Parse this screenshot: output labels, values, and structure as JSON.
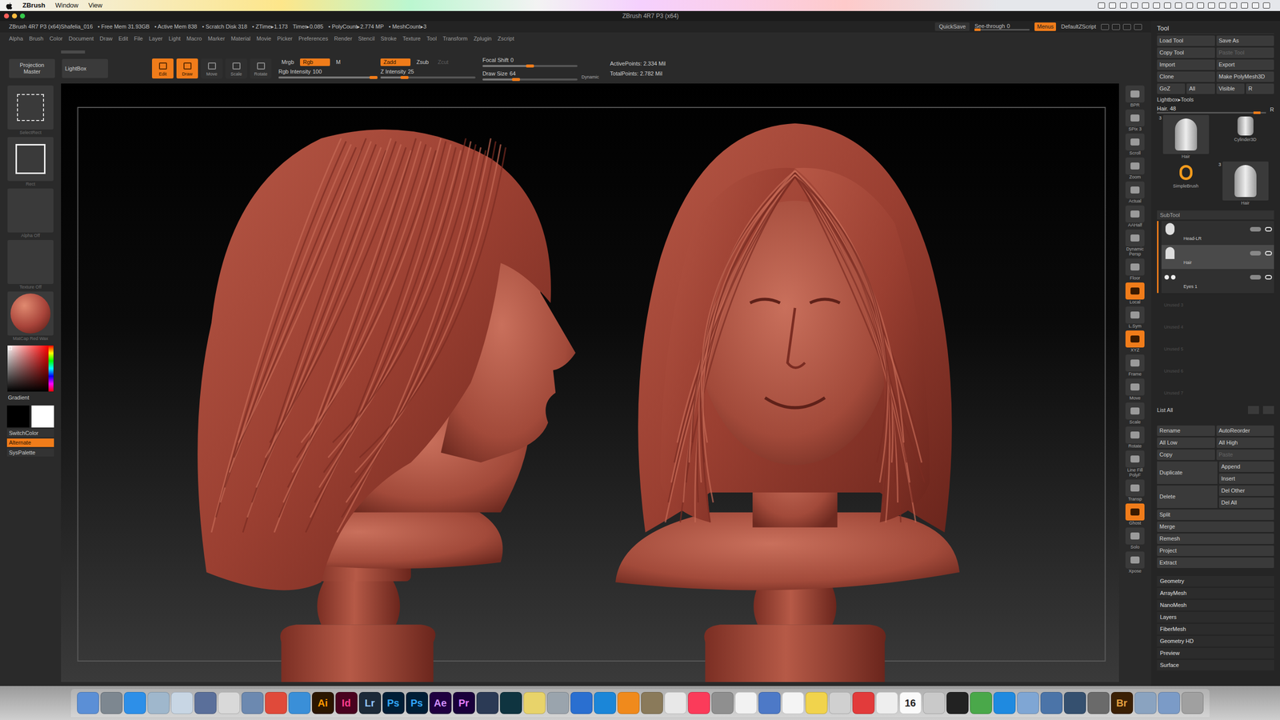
{
  "os_menubar": {
    "app": "ZBrush",
    "menus": [
      "Window",
      "View"
    ]
  },
  "window": {
    "title": "ZBrush 4R7 P3 (x64)"
  },
  "info_bar": {
    "items": [
      "ZBrush 4R7 P3 (x64)Shafelia_016",
      "• Free Mem 31.93GB",
      "• Active Mem 838",
      "• Scratch Disk 318",
      "• ZTime▸1.173",
      "Timer▸0.085",
      "• PolyCount▸2.774 MP",
      "• MeshCount▸3"
    ],
    "quicksave": "QuickSave",
    "see_through": {
      "label": "See-through",
      "value": "0",
      "level": 0
    },
    "menus_toggle": {
      "label": "Menus",
      "on": true
    },
    "script": "DefaultZScript"
  },
  "menu_bar": [
    "Alpha",
    "Brush",
    "Color",
    "Document",
    "Draw",
    "Edit",
    "File",
    "Layer",
    "Light",
    "Macro",
    "Marker",
    "Material",
    "Movie",
    "Picker",
    "Preferences",
    "Render",
    "Stencil",
    "Stroke",
    "Texture",
    "Tool",
    "Transform",
    "Zplugin",
    "Zscript"
  ],
  "shelf": {
    "projection_master": "Projection Master",
    "lightbox": "LightBox",
    "modes": [
      {
        "label": "Edit",
        "selected": true
      },
      {
        "label": "Draw",
        "selected": true
      },
      {
        "label": "Move",
        "selected": false
      },
      {
        "label": "Scale",
        "selected": false
      },
      {
        "label": "Rotate",
        "selected": false
      }
    ],
    "color_modes": [
      {
        "label": "Mrgb",
        "selected": false
      },
      {
        "label": "Rgb",
        "selected": true
      },
      {
        "label": "M",
        "selected": false
      }
    ],
    "rgb_intensity": {
      "label": "Rgb Intensity",
      "value": "100",
      "level": 1
    },
    "z_modes": [
      {
        "label": "Zadd",
        "selected": true,
        "disabled": false
      },
      {
        "label": "Zsub",
        "selected": false,
        "disabled": false
      },
      {
        "label": "Zcut",
        "selected": false,
        "disabled": true
      }
    ],
    "z_intensity": {
      "label": "Z Intensity",
      "value": "25",
      "level": 0.25
    },
    "focal_shift": {
      "label": "Focal Shift",
      "value": "0",
      "level": 0.5
    },
    "draw_size": {
      "label": "Draw Size",
      "value": "64",
      "level": 0.35
    },
    "dynamic": "Dynamic",
    "active_points": "ActivePoints: 2.334 Mil",
    "total_points": "TotalPoints: 2.782 Mil"
  },
  "left_shelf": {
    "tiles": [
      {
        "label": "SelectRect",
        "kind": "selectrect"
      },
      {
        "label": "Rect",
        "kind": "rect"
      },
      {
        "label": "Alpha Off",
        "kind": "blank"
      },
      {
        "label": "Texture Off",
        "kind": "blank"
      },
      {
        "label": "MatCap Red Wax",
        "kind": "sphere"
      }
    ],
    "gradient": "Gradient",
    "primary_color": "#000000",
    "secondary_color": "#ffffff",
    "switch_color": "SwitchColor",
    "alternate": {
      "label": "Alternate",
      "on": true
    },
    "sys_palette": "SysPalette"
  },
  "right_shelf": [
    {
      "label": "BPR",
      "selected": false
    },
    {
      "label": "SPix 3",
      "selected": false
    },
    {
      "label": "Scroll",
      "selected": false
    },
    {
      "label": "Zoom",
      "selected": false
    },
    {
      "label": "Actual",
      "selected": false
    },
    {
      "label": "AAHalf",
      "selected": false
    },
    {
      "label": "Dynamic Persp",
      "selected": false
    },
    {
      "label": "Floor",
      "selected": false
    },
    {
      "label": "Local",
      "selected": true
    },
    {
      "label": "L.Sym",
      "selected": false
    },
    {
      "label": "XYZ",
      "selected": true
    },
    {
      "label": "Frame",
      "selected": false
    },
    {
      "label": "Move",
      "selected": false
    },
    {
      "label": "Scale",
      "selected": false
    },
    {
      "label": "Rotate",
      "selected": false
    },
    {
      "label": "Line Fill PolyF",
      "selected": false
    },
    {
      "label": "Transp",
      "selected": false
    },
    {
      "label": "Ghost",
      "selected": true
    },
    {
      "label": "Solo",
      "selected": false
    },
    {
      "label": "Xpose",
      "selected": false
    }
  ],
  "tool_panel": {
    "title": "Tool",
    "buttons": [
      [
        {
          "label": "Load Tool",
          "disabled": false
        },
        {
          "label": "Save As",
          "disabled": false
        }
      ],
      [
        {
          "label": "Copy Tool",
          "disabled": false
        },
        {
          "label": "Paste Tool",
          "disabled": true
        }
      ],
      [
        {
          "label": "Import",
          "disabled": false
        },
        {
          "label": "Export",
          "disabled": false
        }
      ],
      [
        {
          "label": "Clone",
          "disabled": false
        },
        {
          "label": "Make PolyMesh3D",
          "disabled": false
        }
      ],
      [
        {
          "label": "GoZ",
          "disabled": false
        },
        {
          "label": "All",
          "disabled": false
        },
        {
          "label": "Visible",
          "disabled": false
        },
        {
          "label": "R",
          "disabled": false
        }
      ]
    ],
    "lightbox_tools": "Lightbox▸Tools",
    "current": {
      "label": "Hair. 48",
      "level": 0.95,
      "reset": "R"
    },
    "thumbs": [
      {
        "label": "Hair",
        "count": "3",
        "kind": "hair"
      },
      {
        "label": "Cylinder3D",
        "count": "",
        "kind": "cylinder"
      },
      {
        "label": "SimpleBrush",
        "count": "",
        "kind": "brush"
      },
      {
        "label": "Hair",
        "count": "3",
        "kind": "hair"
      }
    ],
    "subtool": {
      "title": "SubTool",
      "items": [
        {
          "name": "Head-LR",
          "kind": "head",
          "selected": false,
          "visible": true
        },
        {
          "name": "Hair",
          "kind": "hair",
          "selected": true,
          "visible": true
        },
        {
          "name": "Eyes 1",
          "kind": "eyes",
          "selected": false,
          "visible": true
        }
      ],
      "unused": [
        "Unused 3",
        "Unused 4",
        "Unused 5",
        "Unused 6",
        "Unused 7"
      ],
      "list_all": "List All"
    },
    "actions": [
      [
        {
          "label": "Rename",
          "disabled": false
        },
        {
          "label": "AutoReorder",
          "disabled": false
        }
      ],
      [
        {
          "label": "All Low",
          "disabled": false
        },
        {
          "label": "All High",
          "disabled": false
        }
      ],
      [
        {
          "label": "Copy",
          "disabled": false
        },
        {
          "label": "Paste",
          "disabled": true
        }
      ]
    ],
    "duplicate": {
      "label": "Duplicate",
      "options": [
        "Append",
        "Insert"
      ]
    },
    "delete": {
      "label": "Delete",
      "options": [
        "Del Other",
        "Del All"
      ]
    },
    "single_actions": [
      "Split",
      "Merge",
      "Remesh",
      "Project",
      "Extract"
    ],
    "sections": [
      "Geometry",
      "ArrayMesh",
      "NanoMesh",
      "Layers",
      "FiberMesh",
      "Geometry HD",
      "Preview",
      "Surface"
    ]
  },
  "dock": [
    {
      "label": "",
      "color": "#5b8fd6",
      "text_color": "#ffffff"
    },
    {
      "label": "",
      "color": "#7d8790",
      "text_color": "#ffffff"
    },
    {
      "label": "",
      "color": "#2d8fe8",
      "text_color": "#ffffff"
    },
    {
      "label": "",
      "color": "#9fb7cc",
      "text_color": "#ffffff"
    },
    {
      "label": "",
      "color": "#c8d6e4",
      "text_color": "#ffffff"
    },
    {
      "label": "",
      "color": "#5a6f9a",
      "text_color": "#ffffff"
    },
    {
      "label": "",
      "color": "#d9d9d9",
      "text_color": "#ffffff"
    },
    {
      "label": "",
      "color": "#6c89b0",
      "text_color": "#ffffff"
    },
    {
      "label": "",
      "color": "#e04a3a",
      "text_color": "#ffffff"
    },
    {
      "label": "",
      "color": "#3a8fd8",
      "text_color": "#ffffff"
    },
    {
      "label": "Ai",
      "color": "#2b1600",
      "text_color": "#ff9a00"
    },
    {
      "label": "Id",
      "color": "#49021f",
      "text_color": "#ff3d8f"
    },
    {
      "label": "Lr",
      "color": "#1d2a38",
      "text_color": "#94c6ff"
    },
    {
      "label": "Ps",
      "color": "#001e36",
      "text_color": "#31a8ff"
    },
    {
      "label": "Ps",
      "color": "#001e36",
      "text_color": "#31a8ff"
    },
    {
      "label": "Ae",
      "color": "#1f0040",
      "text_color": "#d291ff"
    },
    {
      "label": "Pr",
      "color": "#1a003b",
      "text_color": "#e580ff"
    },
    {
      "label": "",
      "color": "#2b3a55",
      "text_color": "#ffffff"
    },
    {
      "label": "",
      "color": "#0f3440",
      "text_color": "#ffffff"
    },
    {
      "label": "",
      "color": "#e8d36a",
      "text_color": "#ffffff"
    },
    {
      "label": "",
      "color": "#9aa4ad",
      "text_color": "#ffffff"
    },
    {
      "label": "",
      "color": "#2a6fd0",
      "text_color": "#ffffff"
    },
    {
      "label": "",
      "color": "#1b86d8",
      "text_color": "#ffffff"
    },
    {
      "label": "",
      "color": "#f08a1c",
      "text_color": "#ffffff"
    },
    {
      "label": "",
      "color": "#8a7a5a",
      "text_color": "#ffffff"
    },
    {
      "label": "",
      "color": "#e8e8e8",
      "text_color": "#ffffff"
    },
    {
      "label": "",
      "color": "#fb3b5a",
      "text_color": "#ffffff"
    },
    {
      "label": "",
      "color": "#8f8f8f",
      "text_color": "#ffffff"
    },
    {
      "label": "",
      "color": "#f2f2f2",
      "text_color": "#ffffff"
    },
    {
      "label": "",
      "color": "#4d79c7",
      "text_color": "#ffffff"
    },
    {
      "label": "",
      "color": "#f4f4f4",
      "text_color": "#ffffff"
    },
    {
      "label": "",
      "color": "#f1d34c",
      "text_color": "#ffffff"
    },
    {
      "label": "",
      "color": "#d0d0d0",
      "text_color": "#ffffff"
    },
    {
      "label": "",
      "color": "#e23b3b",
      "text_color": "#ffffff"
    },
    {
      "label": "",
      "color": "#eeeeee",
      "text_color": "#ffffff"
    },
    {
      "label": "16",
      "color": "#fafafa",
      "text_color": "#222222"
    },
    {
      "label": "",
      "color": "#c9c9c9",
      "text_color": "#ffffff"
    },
    {
      "label": "",
      "color": "#222222",
      "text_color": "#ffffff"
    },
    {
      "label": "",
      "color": "#4aa84a",
      "text_color": "#ffffff"
    },
    {
      "label": "",
      "color": "#1f8ae0",
      "text_color": "#ffffff"
    },
    {
      "label": "",
      "color": "#7fa6d4",
      "text_color": "#ffffff"
    },
    {
      "label": "",
      "color": "#4b74a8",
      "text_color": "#ffffff"
    },
    {
      "label": "",
      "color": "#35506f",
      "text_color": "#ffffff"
    },
    {
      "label": "",
      "color": "#6a6a6a",
      "text_color": "#ffffff"
    },
    {
      "label": "Br",
      "color": "#3b2005",
      "text_color": "#e6a040"
    },
    {
      "label": "",
      "color": "#8aa3c0",
      "text_color": "#ffffff"
    },
    {
      "label": "",
      "color": "#7b9bc7",
      "text_color": "#ffffff"
    },
    {
      "label": "",
      "color": "#a0a0a0",
      "text_color": "#ffffff"
    }
  ]
}
